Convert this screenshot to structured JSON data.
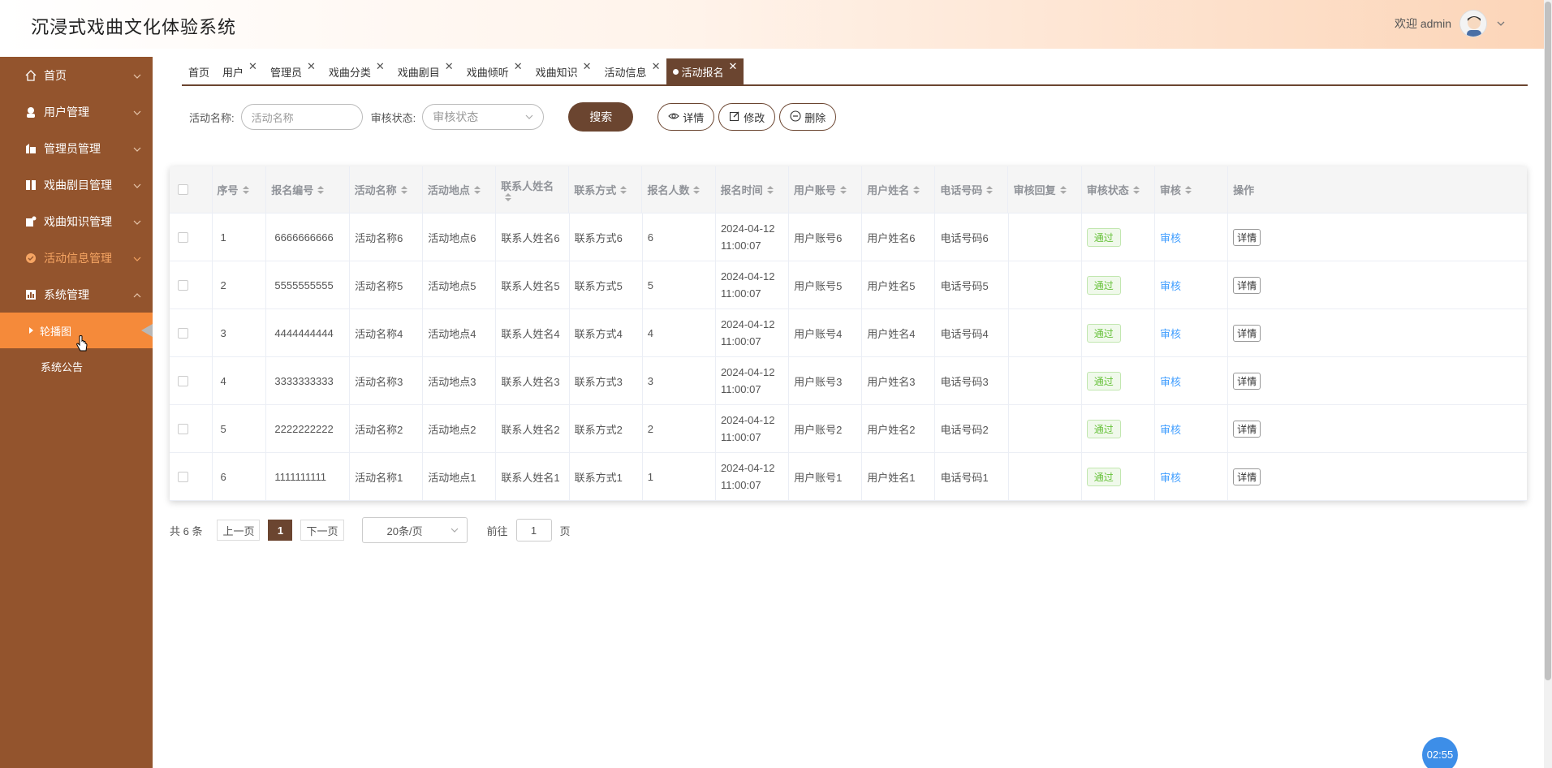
{
  "header": {
    "title": "沉浸式戏曲文化体验系统",
    "welcome": "欢迎 admin"
  },
  "sidebar": {
    "items": [
      {
        "label": "首页",
        "icon": "home-icon"
      },
      {
        "label": "用户管理",
        "icon": "user-icon"
      },
      {
        "label": "管理员管理",
        "icon": "admin-icon"
      },
      {
        "label": "戏曲剧目管理",
        "icon": "book-icon"
      },
      {
        "label": "戏曲知识管理",
        "icon": "knowledge-icon"
      },
      {
        "label": "活动信息管理",
        "icon": "activity-icon"
      },
      {
        "label": "系统管理",
        "icon": "chart-icon"
      }
    ],
    "sub_items": [
      {
        "label": "轮播图"
      },
      {
        "label": "系统公告"
      }
    ]
  },
  "tabs": [
    {
      "label": "首页"
    },
    {
      "label": "用户"
    },
    {
      "label": "管理员"
    },
    {
      "label": "戏曲分类"
    },
    {
      "label": "戏曲剧目"
    },
    {
      "label": "戏曲倾听"
    },
    {
      "label": "戏曲知识"
    },
    {
      "label": "活动信息"
    },
    {
      "label": "活动报名"
    }
  ],
  "search": {
    "name_label": "活动名称:",
    "name_placeholder": "活动名称",
    "status_label": "审核状态:",
    "status_placeholder": "审核状态",
    "search_button": "搜索",
    "detail_button": "详情",
    "edit_button": "修改",
    "delete_button": "删除"
  },
  "table": {
    "columns": [
      "序号",
      "报名编号",
      "活动名称",
      "活动地点",
      "联系人姓名",
      "联系方式",
      "报名人数",
      "报名时间",
      "用户账号",
      "用户姓名",
      "电话号码",
      "审核回复",
      "审核状态",
      "审核",
      "操作"
    ],
    "audit_link": "审核",
    "detail_button": "详情",
    "rows": [
      {
        "no": "1",
        "code": "6666666666",
        "name": "活动名称6",
        "place": "活动地点6",
        "contact": "联系人姓名6",
        "phone_contact": "联系方式6",
        "count": "6",
        "date": "2024-04-12",
        "time": "11:00:07",
        "account": "用户账号6",
        "uname": "用户姓名6",
        "tel": "电话号码6",
        "reply": "",
        "status": "通过"
      },
      {
        "no": "2",
        "code": "5555555555",
        "name": "活动名称5",
        "place": "活动地点5",
        "contact": "联系人姓名5",
        "phone_contact": "联系方式5",
        "count": "5",
        "date": "2024-04-12",
        "time": "11:00:07",
        "account": "用户账号5",
        "uname": "用户姓名5",
        "tel": "电话号码5",
        "reply": "",
        "status": "通过"
      },
      {
        "no": "3",
        "code": "4444444444",
        "name": "活动名称4",
        "place": "活动地点4",
        "contact": "联系人姓名4",
        "phone_contact": "联系方式4",
        "count": "4",
        "date": "2024-04-12",
        "time": "11:00:07",
        "account": "用户账号4",
        "uname": "用户姓名4",
        "tel": "电话号码4",
        "reply": "",
        "status": "通过"
      },
      {
        "no": "4",
        "code": "3333333333",
        "name": "活动名称3",
        "place": "活动地点3",
        "contact": "联系人姓名3",
        "phone_contact": "联系方式3",
        "count": "3",
        "date": "2024-04-12",
        "time": "11:00:07",
        "account": "用户账号3",
        "uname": "用户姓名3",
        "tel": "电话号码3",
        "reply": "",
        "status": "通过"
      },
      {
        "no": "5",
        "code": "2222222222",
        "name": "活动名称2",
        "place": "活动地点2",
        "contact": "联系人姓名2",
        "phone_contact": "联系方式2",
        "count": "2",
        "date": "2024-04-12",
        "time": "11:00:07",
        "account": "用户账号2",
        "uname": "用户姓名2",
        "tel": "电话号码2",
        "reply": "",
        "status": "通过"
      },
      {
        "no": "6",
        "code": "1111111111",
        "name": "活动名称1",
        "place": "活动地点1",
        "contact": "联系人姓名1",
        "phone_contact": "联系方式1",
        "count": "1",
        "date": "2024-04-12",
        "time": "11:00:07",
        "account": "用户账号1",
        "uname": "用户姓名1",
        "tel": "电话号码1",
        "reply": "",
        "status": "通过"
      }
    ]
  },
  "pagination": {
    "total": "共 6 条",
    "prev": "上一页",
    "current": "1",
    "next": "下一页",
    "page_size": "20条/页",
    "goto_label": "前往",
    "goto_value": "1",
    "page_unit": "页"
  },
  "timer": "02:55",
  "colors": {
    "sidebar": "#93542d",
    "accent": "#6b4530",
    "selected": "#f58a3a",
    "active_text": "#f6a563"
  }
}
